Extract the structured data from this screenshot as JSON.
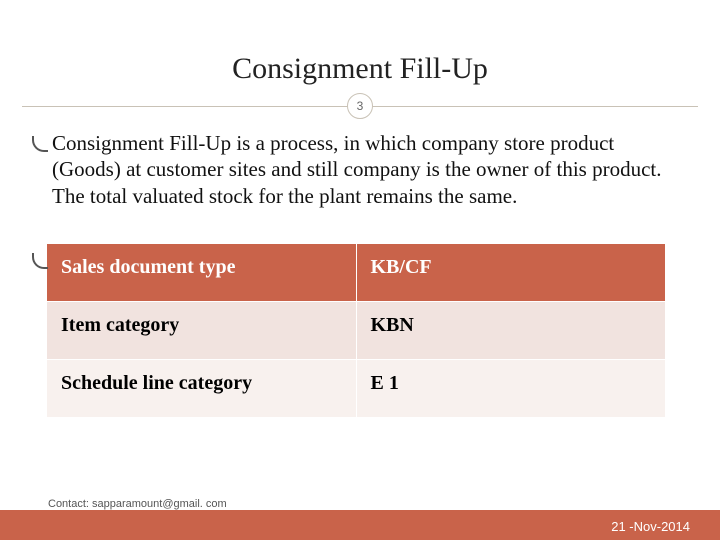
{
  "title": "Consignment Fill-Up",
  "page_number": "3",
  "paragraph": "Consignment Fill-Up is a process, in which  company store product (Goods) at customer sites and still company  is the owner of this product. The total valuated stock for the plant remains the same.",
  "table": {
    "rows": [
      {
        "key": "Sales document type",
        "value": "KB/CF"
      },
      {
        "key": "Item category",
        "value": "KBN"
      },
      {
        "key": "Schedule line category",
        "value": "E 1"
      }
    ]
  },
  "contact": "Contact: sapparamount@gmail. com",
  "date": "21 -Nov-2014"
}
